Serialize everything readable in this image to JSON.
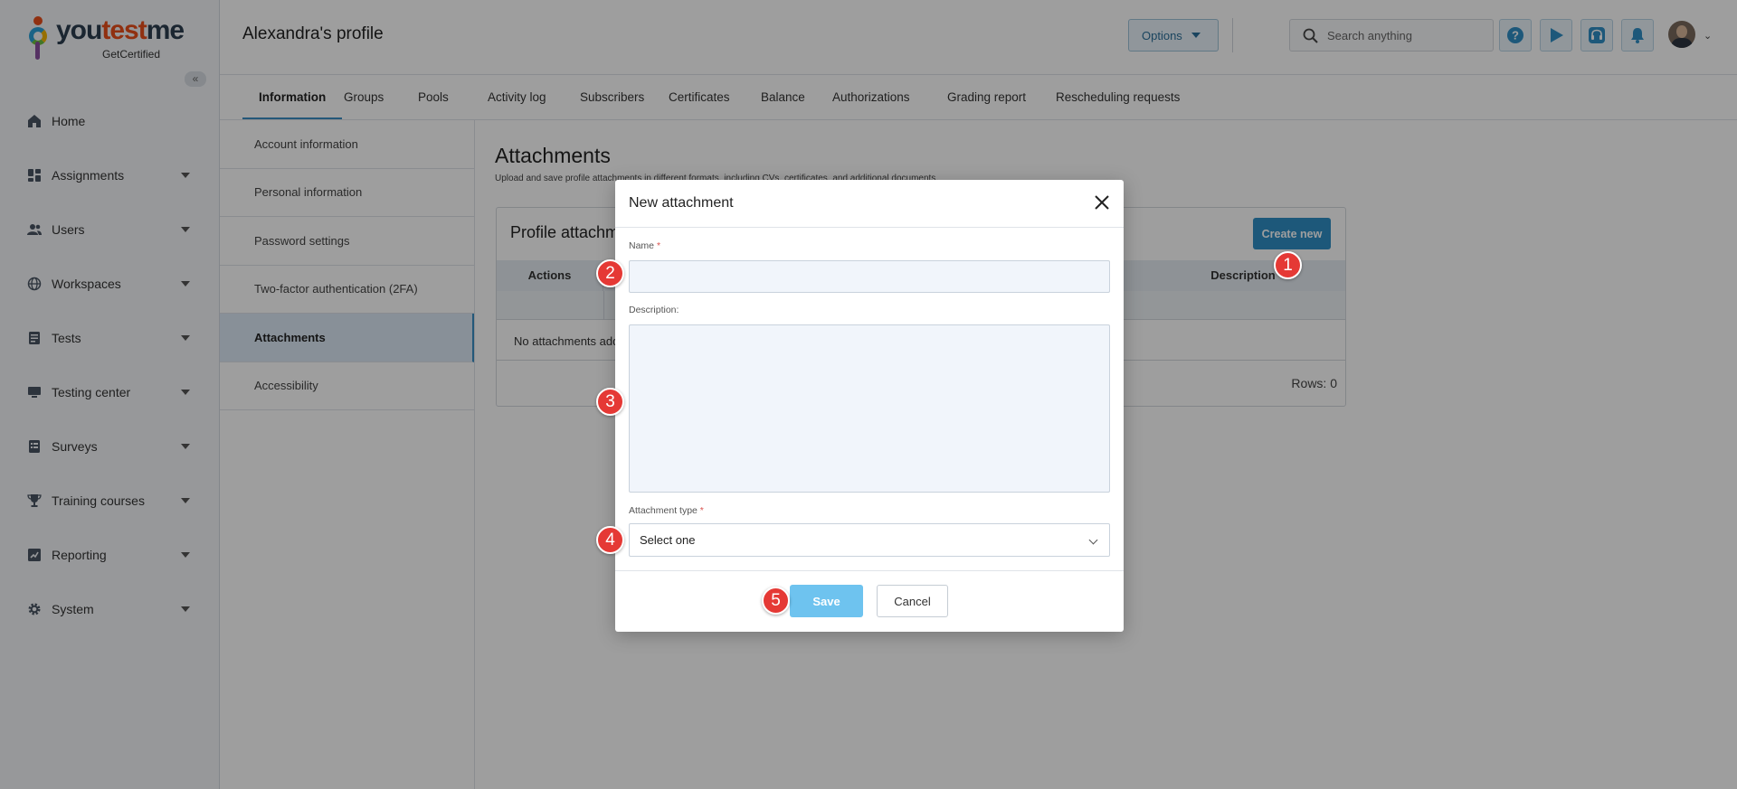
{
  "brand": {
    "name_part1": "you",
    "name_part2": "test",
    "name_part3": "me",
    "subtitle": "GetCertified"
  },
  "sidebar": {
    "items": [
      {
        "label": "Home",
        "icon": "home-icon"
      },
      {
        "label": "Assignments",
        "icon": "assignments-icon"
      },
      {
        "label": "Users",
        "icon": "users-icon"
      },
      {
        "label": "Workspaces",
        "icon": "globe-icon"
      },
      {
        "label": "Tests",
        "icon": "tests-icon"
      },
      {
        "label": "Testing center",
        "icon": "monitor-icon"
      },
      {
        "label": "Surveys",
        "icon": "survey-icon"
      },
      {
        "label": "Training courses",
        "icon": "trophy-icon"
      },
      {
        "label": "Reporting",
        "icon": "chart-icon"
      },
      {
        "label": "System",
        "icon": "gear-icon"
      }
    ]
  },
  "header": {
    "title": "Alexandra's profile",
    "options_label": "Options",
    "search_placeholder": "Search anything"
  },
  "tabs": [
    "Information",
    "Groups",
    "Pools",
    "Activity log",
    "Subscribers",
    "Certificates",
    "Balance",
    "Authorizations",
    "Grading report",
    "Rescheduling requests"
  ],
  "submenu": [
    "Account information",
    "Personal information",
    "Password settings",
    "Two-factor authentication (2FA)",
    "Attachments",
    "Accessibility"
  ],
  "content": {
    "title": "Attachments",
    "subtitle": "Upload and save profile attachments in different formats, including CVs, certificates, and additional documents.",
    "panel_title": "Profile attachments",
    "create_label": "Create new",
    "col_actions": "Actions",
    "col_description": "Description",
    "empty_text": "No attachments added.",
    "rows_text": "Rows: 0"
  },
  "modal": {
    "title": "New attachment",
    "name_label": "Name",
    "description_label": "Description:",
    "type_label": "Attachment type",
    "required_mark": "*",
    "type_value": "Select one",
    "save_label": "Save",
    "cancel_label": "Cancel"
  },
  "steps": [
    "1",
    "2",
    "3",
    "4",
    "5"
  ],
  "colors": {
    "accent": "#2f8fc6",
    "badge": "#e53935",
    "active_sub": "#dbe9f6"
  }
}
